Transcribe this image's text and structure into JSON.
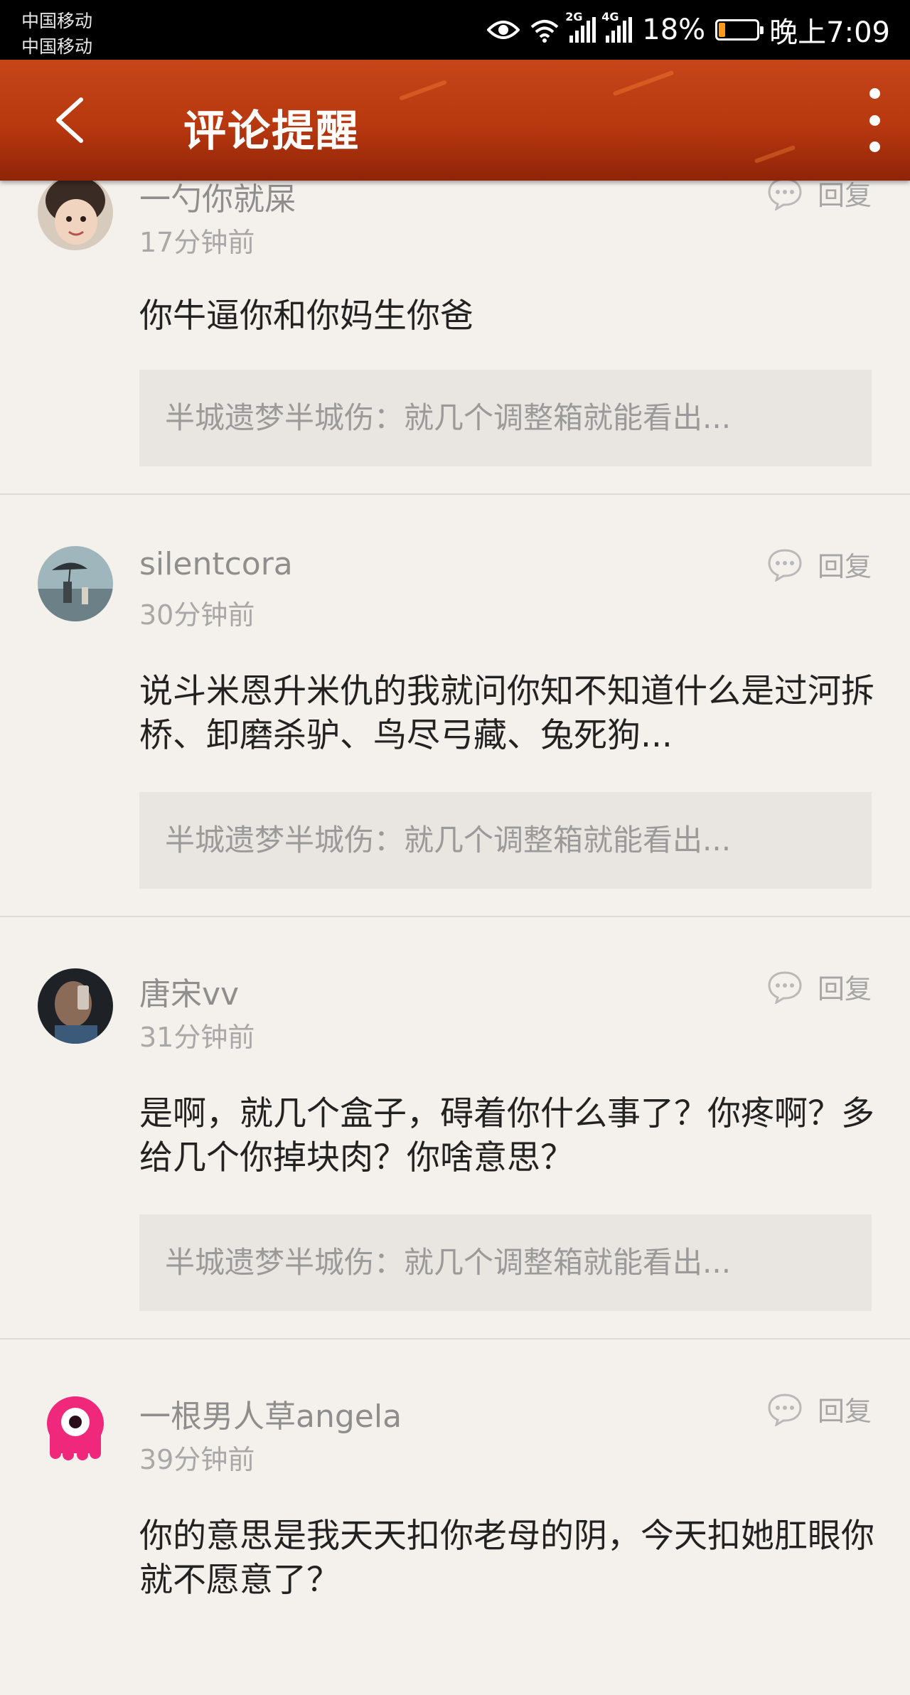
{
  "status_bar": {
    "carrier_1": "中国移动",
    "carrier_2": "中国移动",
    "sim1_type": "2G",
    "sim2_type": "4G",
    "battery": "18%",
    "battery_level": 0.18,
    "time": "晚上7:09",
    "icons": [
      "eye-icon",
      "wifi-icon",
      "signal-icon",
      "battery-icon"
    ]
  },
  "header": {
    "title": "评论提醒",
    "back_icon": "chevron-left-icon",
    "more_icon": "more-vertical-icon"
  },
  "reply_label": "回复",
  "comments": [
    {
      "name": "一勺你就屎",
      "time": "17分钟前",
      "content": "你牛逼你和你妈生你爸",
      "quote": "半城遗梦半城伤：就几个调整箱就能看出..."
    },
    {
      "name": "silentcora",
      "time": "30分钟前",
      "content": "说斗米恩升米仇的我就问你知不知道什么是过河拆桥、卸磨杀驴、鸟尽弓藏、兔死狗...",
      "quote": "半城遗梦半城伤：就几个调整箱就能看出..."
    },
    {
      "name": "唐宋vv",
      "time": "31分钟前",
      "content": "是啊，就几个盒子，碍着你什么事了？你疼啊？多给几个你掉块肉？你啥意思？",
      "quote": "半城遗梦半城伤：就几个调整箱就能看出..."
    },
    {
      "name": "一根男人草angela",
      "time": "39分钟前",
      "content": "你的意思是我天天扣你老母的阴，今天扣她肛眼你就不愿意了？",
      "quote": ""
    }
  ],
  "colors": {
    "header": "#b8380f",
    "background": "#f4f1ec",
    "quote_bg": "#e9e6e1",
    "battery_fill": "#ff9a1a"
  }
}
